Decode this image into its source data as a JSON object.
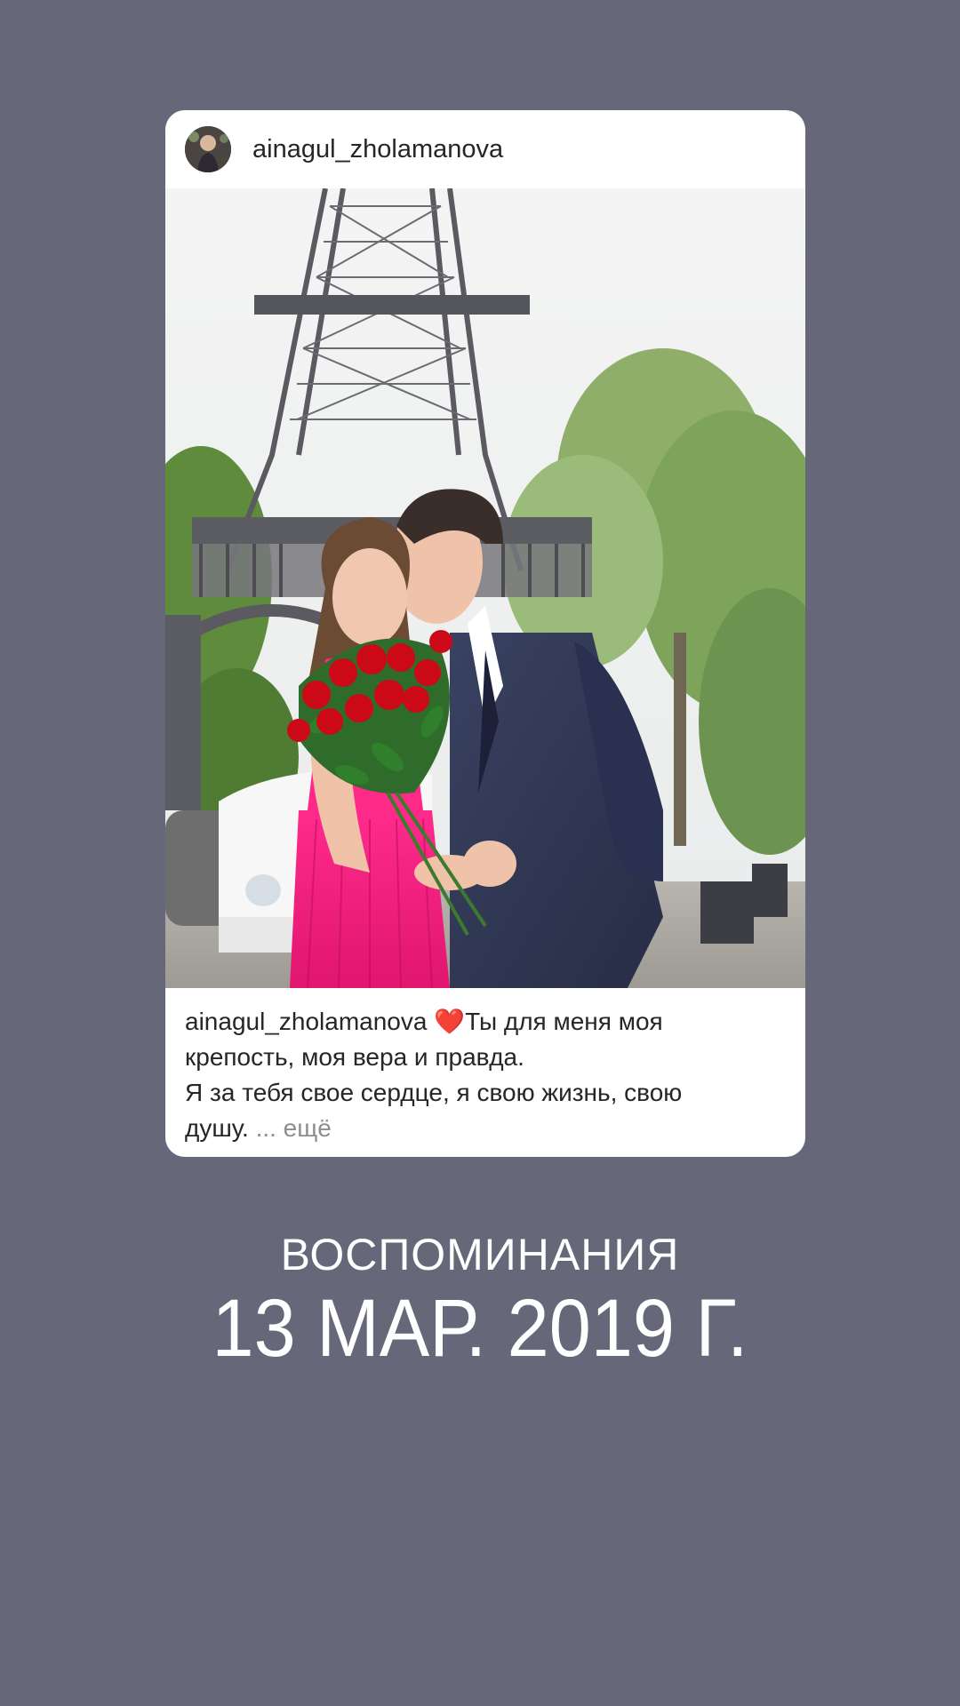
{
  "post": {
    "username": "ainagul_zholamanova",
    "caption": {
      "author": "ainagul_zholamanova",
      "emoji": "❤️",
      "line1": "Ты для меня моя",
      "line2": "крепость, моя вера и правда.",
      "line3": "Я за тебя свое сердце, я свою жизнь, свою",
      "line4": "душу.",
      "more": "... ещё"
    },
    "avatar_icon": "profile-photo",
    "photo_description_icon": "couple-eiffel-tower-photo"
  },
  "memory": {
    "label": "ВОСПОМИНАНИЯ",
    "date": "13 МАР. 2019 Г."
  },
  "colors": {
    "background": "#666778",
    "card": "#ffffff",
    "text": "#262626",
    "muted": "#8e8e8e",
    "heart": "#e0162b"
  }
}
